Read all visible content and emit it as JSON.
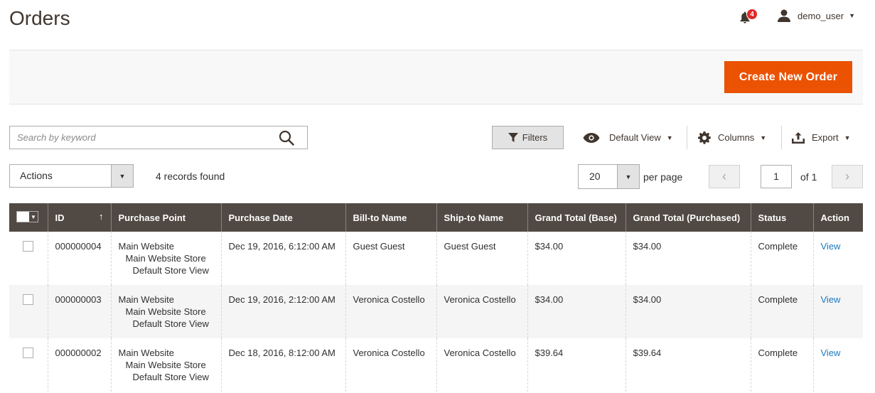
{
  "page": {
    "title": "Orders"
  },
  "header": {
    "notifications_count": "4",
    "username": "demo_user"
  },
  "action_bar": {
    "create_button": "Create New Order"
  },
  "search": {
    "placeholder": "Search by keyword"
  },
  "toolbar": {
    "filters": "Filters",
    "view": "Default View",
    "columns": "Columns",
    "export": "Export"
  },
  "mass_actions": {
    "label": "Actions"
  },
  "records_found": "4 records found",
  "pagination": {
    "per_page_value": "20",
    "per_page_label": "per page",
    "current_page": "1",
    "of_pages": "of 1"
  },
  "grid": {
    "columns": [
      "ID",
      "Purchase Point",
      "Purchase Date",
      "Bill-to Name",
      "Ship-to Name",
      "Grand Total (Base)",
      "Grand Total (Purchased)",
      "Status",
      "Action"
    ],
    "rows": [
      {
        "id": "000000004",
        "pp1": "Main Website",
        "pp2": "Main Website Store",
        "pp3": "Default Store View",
        "date": "Dec 19, 2016, 6:12:00 AM",
        "bill_to": "Guest Guest",
        "ship_to": "Guest Guest",
        "total_base": "$34.00",
        "total_purchased": "$34.00",
        "status": "Complete",
        "action": "View"
      },
      {
        "id": "000000003",
        "pp1": "Main Website",
        "pp2": "Main Website Store",
        "pp3": "Default Store View",
        "date": "Dec 19, 2016, 2:12:00 AM",
        "bill_to": "Veronica Costello",
        "ship_to": "Veronica Costello",
        "total_base": "$34.00",
        "total_purchased": "$34.00",
        "status": "Complete",
        "action": "View"
      },
      {
        "id": "000000002",
        "pp1": "Main Website",
        "pp2": "Main Website Store",
        "pp3": "Default Store View",
        "date": "Dec 18, 2016, 8:12:00 AM",
        "bill_to": "Veronica Costello",
        "ship_to": "Veronica Costello",
        "total_base": "$39.64",
        "total_purchased": "$39.64",
        "status": "Complete",
        "action": "View"
      }
    ]
  },
  "colors": {
    "accent": "#eb5202",
    "grid_header": "#514943",
    "link": "#1979c3",
    "badge": "#e22626"
  }
}
